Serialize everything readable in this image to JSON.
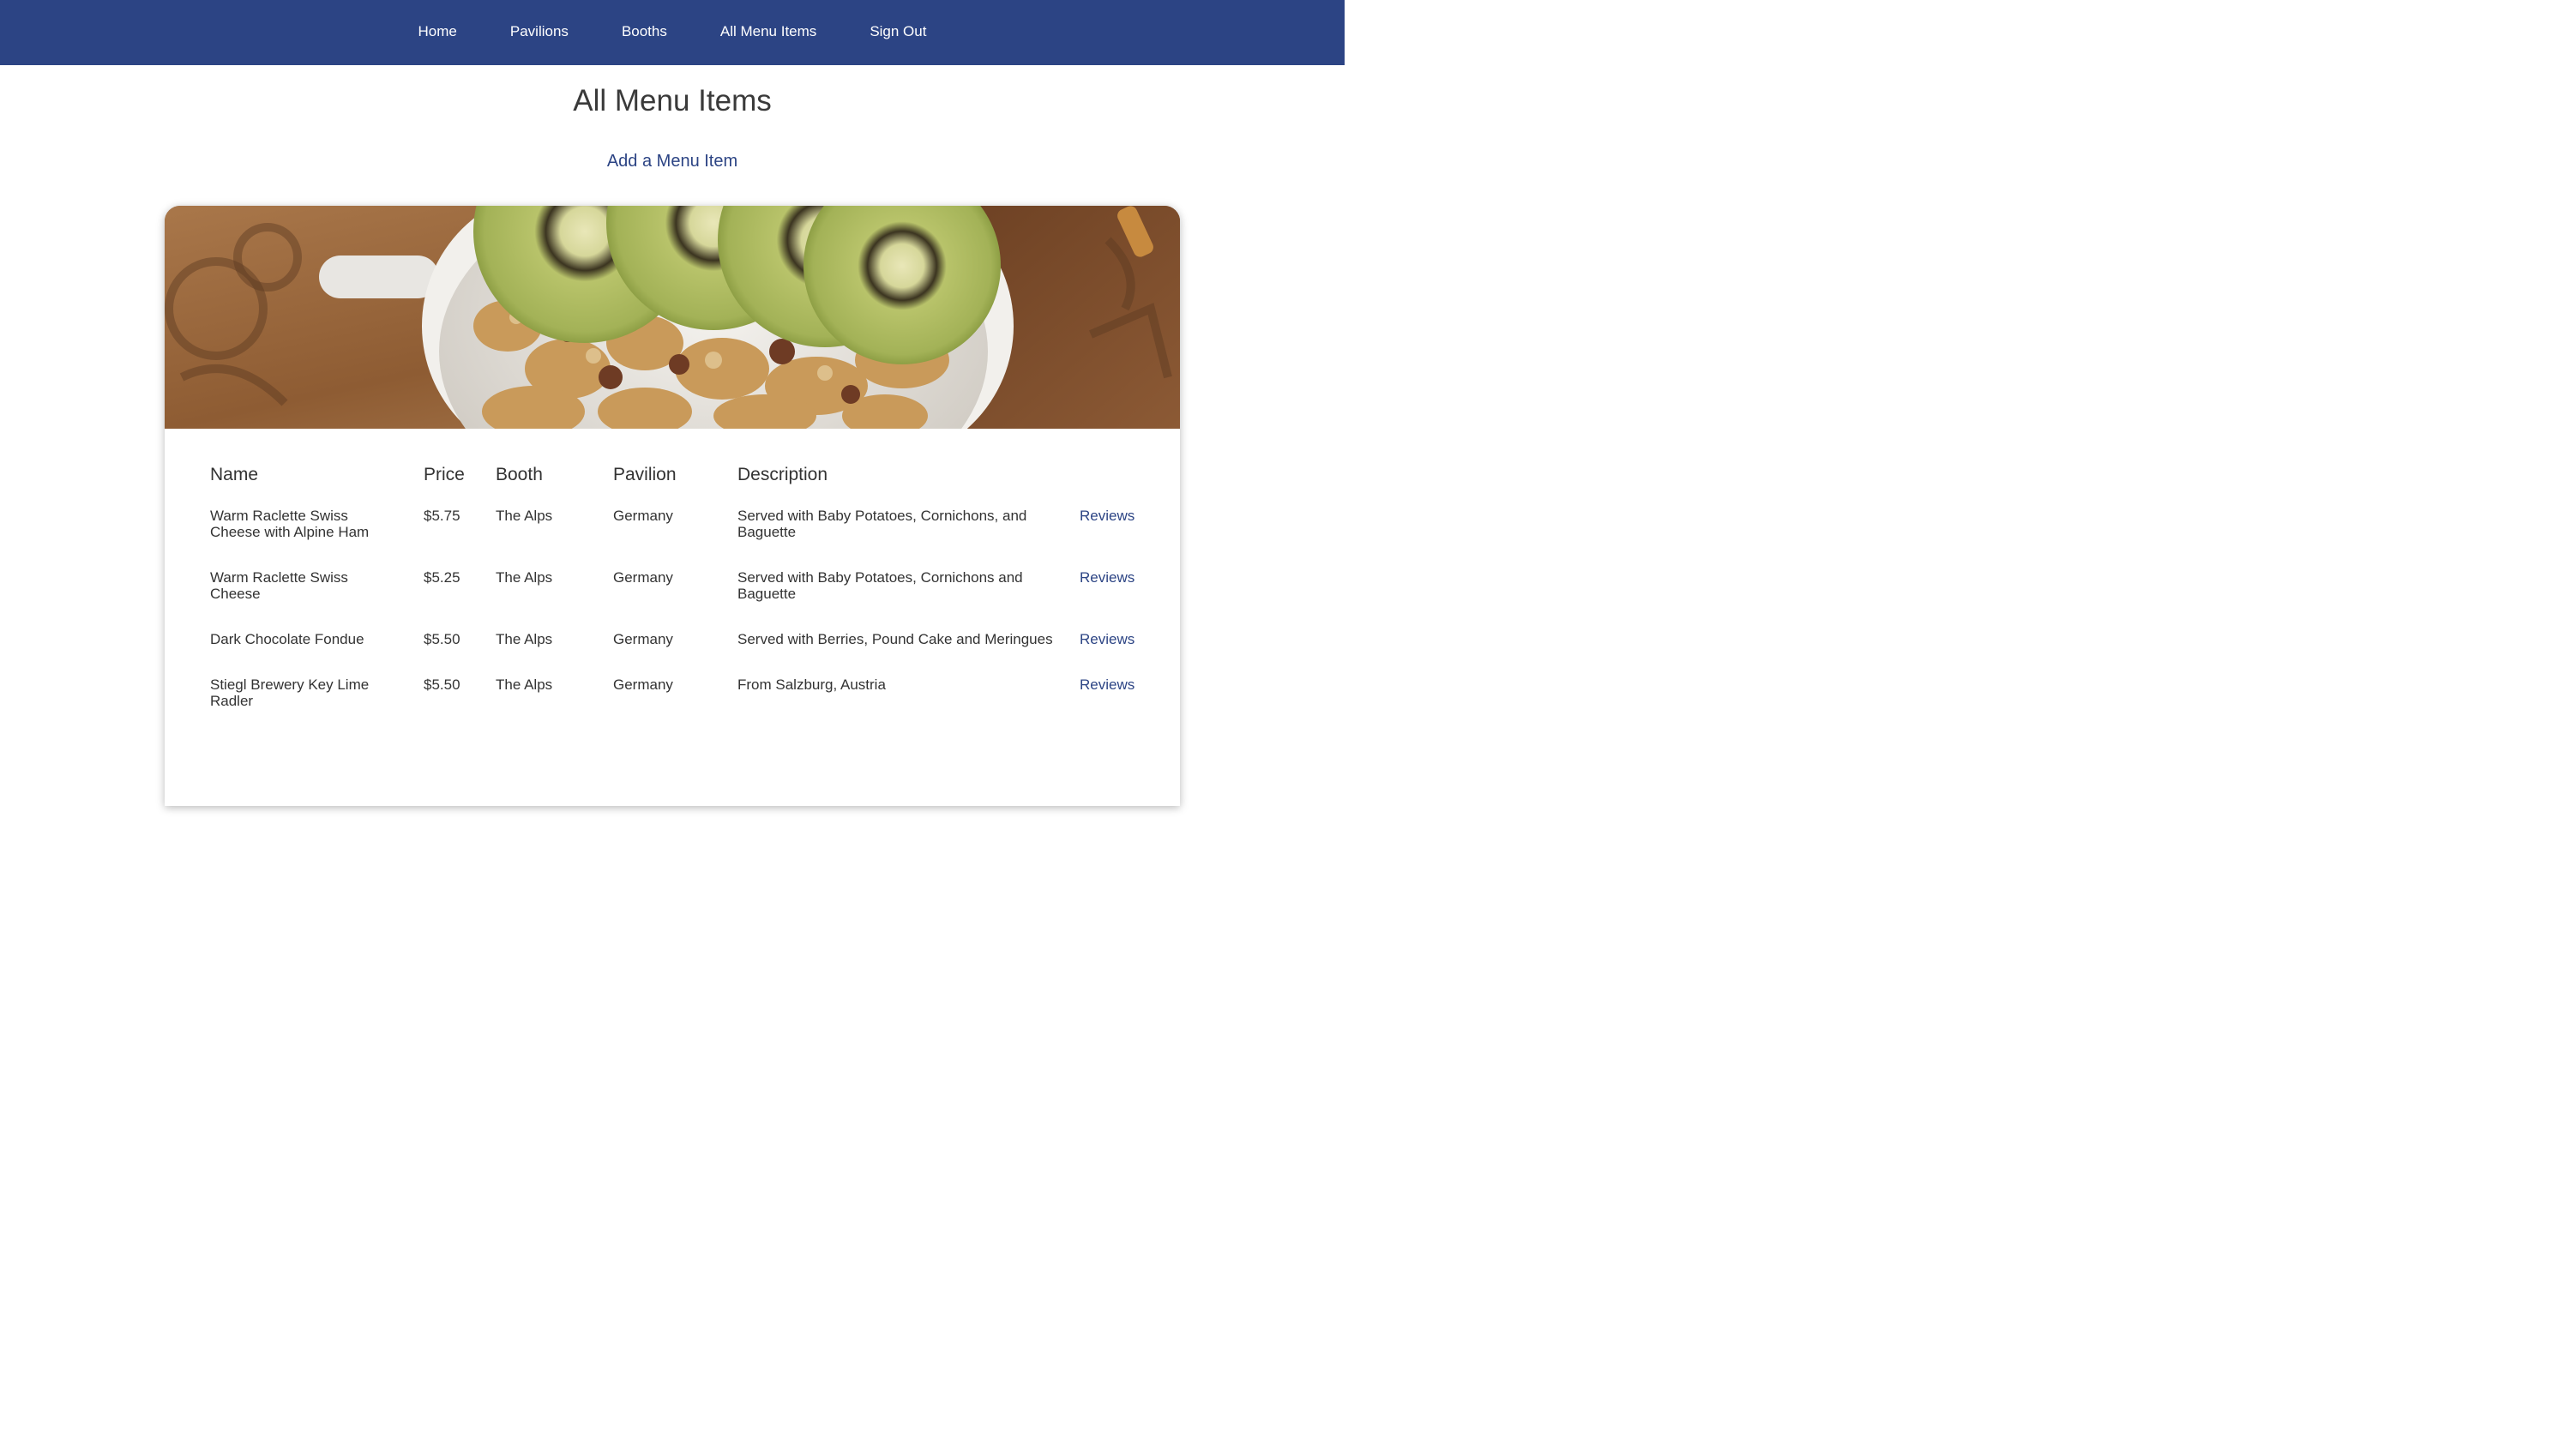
{
  "nav": {
    "items": [
      {
        "label": "Home"
      },
      {
        "label": "Pavilions"
      },
      {
        "label": "Booths"
      },
      {
        "label": "All Menu Items"
      },
      {
        "label": "Sign Out"
      }
    ]
  },
  "page": {
    "title": "All Menu Items",
    "add_link": "Add a Menu Item"
  },
  "table": {
    "headers": [
      "Name",
      "Price",
      "Booth",
      "Pavilion",
      "Description"
    ],
    "rows": [
      {
        "name": "Warm Raclette Swiss Cheese with Alpine Ham",
        "price": "$5.75",
        "booth": "The Alps",
        "pavilion": "Germany",
        "description": "Served with Baby Potatoes, Cornichons, and Baguette",
        "action": "Reviews"
      },
      {
        "name": "Warm Raclette Swiss Cheese",
        "price": "$5.25",
        "booth": "The Alps",
        "pavilion": "Germany",
        "description": "Served with Baby Potatoes, Cornichons and Baguette",
        "action": "Reviews"
      },
      {
        "name": "Dark Chocolate Fondue",
        "price": "$5.50",
        "booth": "The Alps",
        "pavilion": "Germany",
        "description": "Served with Berries, Pound Cake and Meringues",
        "action": "Reviews"
      },
      {
        "name": "Stiegl Brewery Key Lime Radler",
        "price": "$5.50",
        "booth": "The Alps",
        "pavilion": "Germany",
        "description": "From Salzburg, Austria",
        "action": "Reviews"
      }
    ]
  },
  "colors": {
    "nav_bg": "#2c4484",
    "link": "#2c4484",
    "text": "#333333"
  },
  "hero_image": "photo of a bowl of granola topped with kiwi slices on a wooden table"
}
